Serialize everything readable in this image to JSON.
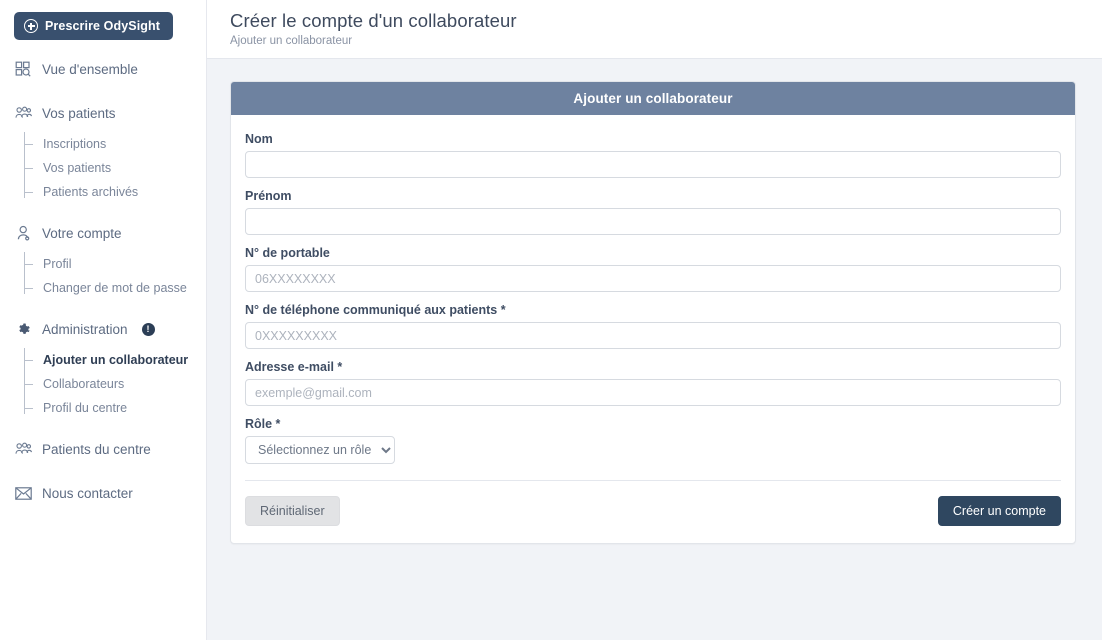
{
  "sidebar": {
    "brand_button": {
      "label": "Prescrire OdySight",
      "icon": "plus-circle-icon"
    },
    "groups": [
      {
        "id": "vue-ensemble",
        "label": "Vue d'ensemble",
        "icon": "dashboard-search-icon",
        "badge": null,
        "children": []
      },
      {
        "id": "vos-patients",
        "label": "Vos patients",
        "icon": "users-icon",
        "badge": null,
        "children": [
          {
            "id": "inscriptions",
            "label": "Inscriptions",
            "active": false
          },
          {
            "id": "vos-patients-sub",
            "label": "Vos patients",
            "active": false
          },
          {
            "id": "patients-archives",
            "label": "Patients archivés",
            "active": false
          }
        ]
      },
      {
        "id": "votre-compte",
        "label": "Votre compte",
        "icon": "user-icon",
        "badge": null,
        "children": [
          {
            "id": "profil",
            "label": "Profil",
            "active": false
          },
          {
            "id": "changer-mot-de-passe",
            "label": "Changer de mot de passe",
            "active": false
          }
        ]
      },
      {
        "id": "administration",
        "label": "Administration",
        "icon": "gear-icon",
        "badge": "!",
        "children": [
          {
            "id": "ajouter-collaborateur",
            "label": "Ajouter un collaborateur",
            "active": true
          },
          {
            "id": "collaborateurs",
            "label": "Collaborateurs",
            "active": false
          },
          {
            "id": "profil-du-centre",
            "label": "Profil du centre",
            "active": false
          }
        ]
      },
      {
        "id": "patients-du-centre",
        "label": "Patients du centre",
        "icon": "users-icon",
        "badge": null,
        "children": []
      },
      {
        "id": "nous-contacter",
        "label": "Nous contacter",
        "icon": "envelope-icon",
        "badge": null,
        "children": []
      }
    ]
  },
  "header": {
    "title": "Créer le compte d'un collaborateur",
    "breadcrumb": "Ajouter un collaborateur"
  },
  "form": {
    "card_title": "Ajouter un collaborateur",
    "fields": [
      {
        "id": "nom",
        "label": "Nom",
        "value": "",
        "placeholder": "",
        "type": "text"
      },
      {
        "id": "prenom",
        "label": "Prénom",
        "value": "",
        "placeholder": "",
        "type": "text"
      },
      {
        "id": "portable",
        "label": "N° de portable",
        "value": "",
        "placeholder": "06XXXXXXXX",
        "type": "text"
      },
      {
        "id": "telephone-patients",
        "label": "N° de téléphone communiqué aux patients *",
        "value": "",
        "placeholder": "0XXXXXXXXX",
        "type": "text"
      },
      {
        "id": "email",
        "label": "Adresse e-mail *",
        "value": "",
        "placeholder": "exemple@gmail.com",
        "type": "text"
      }
    ],
    "role": {
      "label": "Rôle *",
      "selected": "Sélectionnez un rôle",
      "options": [
        "Sélectionnez un rôle"
      ]
    },
    "reset_label": "Réinitialiser",
    "submit_label": "Créer un compte"
  },
  "colors": {
    "brand_dark": "#39506e",
    "card_header": "#6e82a0",
    "submit": "#2f4760",
    "page_bg": "#f1f3f7"
  }
}
